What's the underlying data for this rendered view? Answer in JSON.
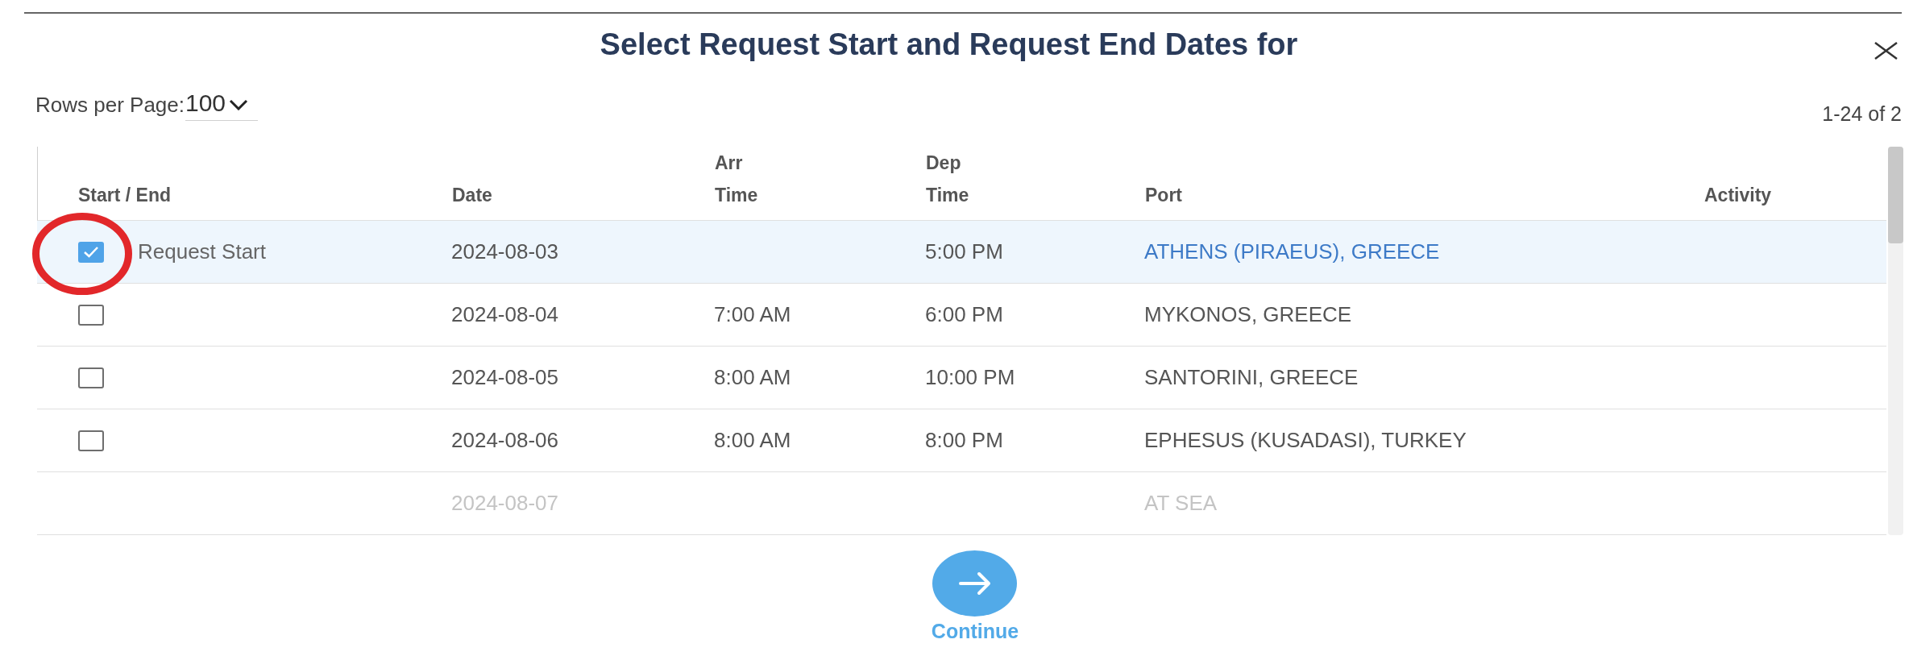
{
  "dialog": {
    "title": "Select Request Start and Request End Dates for"
  },
  "pagination": {
    "rows_per_page_label": "Rows per Page:",
    "rows_per_page_value": "100",
    "range": "1-24 of 2"
  },
  "table": {
    "columns": [
      {
        "label": "Start / End"
      },
      {
        "label": "Date"
      },
      {
        "label": "Arr Time"
      },
      {
        "label": "Dep Time"
      },
      {
        "label": "Port"
      },
      {
        "label": "Activity"
      }
    ],
    "rows": [
      {
        "selected": true,
        "checked": true,
        "circled": true,
        "disabled": false,
        "start_end": "Request Start",
        "date": "2024-08-03",
        "dep_time": "5:00 PM",
        "port": "ATHENS (PIRAEUS), GREECE"
      },
      {
        "selected": false,
        "checked": false,
        "circled": false,
        "disabled": false,
        "date": "2024-08-04",
        "arr_time": "7:00 AM",
        "dep_time": "6:00 PM",
        "port": "MYKONOS, GREECE"
      },
      {
        "selected": false,
        "checked": false,
        "circled": false,
        "disabled": false,
        "date": "2024-08-05",
        "arr_time": "8:00 AM",
        "dep_time": "10:00 PM",
        "port": "SANTORINI, GREECE"
      },
      {
        "selected": false,
        "checked": false,
        "circled": false,
        "disabled": false,
        "date": "2024-08-06",
        "arr_time": "8:00 AM",
        "dep_time": "8:00 PM",
        "port": "EPHESUS (KUSADASI), TURKEY"
      },
      {
        "selected": false,
        "circled": false,
        "disabled": true,
        "date": "2024-08-07",
        "port": "AT SEA"
      }
    ]
  },
  "continue_button": {
    "label": "Continue"
  }
}
